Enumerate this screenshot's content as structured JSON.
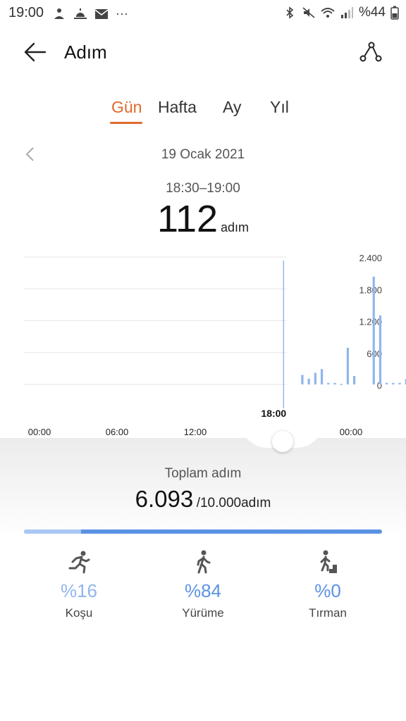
{
  "status_bar": {
    "time": "19:00",
    "battery": "%44",
    "ellipsis": "···"
  },
  "header": {
    "title": "Adım"
  },
  "tabs": [
    {
      "label": "Gün",
      "active": true
    },
    {
      "label": "Hafta",
      "active": false
    },
    {
      "label": "Ay",
      "active": false
    },
    {
      "label": "Yıl",
      "active": false
    }
  ],
  "date": "19 Ocak 2021",
  "selected": {
    "range": "18:30–19:00",
    "value": "112",
    "unit": "adım"
  },
  "chart_data": {
    "type": "bar",
    "y_tick_labels": [
      "2.400",
      "1.800",
      "1.200",
      "600",
      "0"
    ],
    "y_ticks": [
      2400,
      1800,
      1200,
      600,
      0
    ],
    "x_tick_labels": [
      "00:00",
      "06:00",
      "12:00",
      "18:00",
      "00:00"
    ],
    "x_ticks_hours": [
      0,
      6,
      12,
      18,
      24
    ],
    "selected_tick_label": "18:00",
    "ylim": [
      0,
      2400
    ],
    "grid": true,
    "interval_hours": 0.5,
    "values": [
      0,
      0,
      0,
      0,
      0,
      0,
      0,
      0,
      0,
      0,
      0,
      0,
      0,
      0,
      0,
      0,
      0,
      0,
      0,
      0,
      0,
      0,
      0,
      0,
      0,
      0,
      0,
      0,
      0,
      0,
      0,
      0,
      0,
      0,
      0,
      0,
      0,
      0,
      0,
      0,
      180,
      110,
      220,
      290,
      30,
      30,
      10,
      690,
      160,
      0,
      0,
      2030,
      1300,
      30,
      30,
      30,
      100,
      110,
      110,
      200,
      190,
      112,
      0,
      0,
      0,
      0,
      0,
      0,
      0,
      0,
      0,
      0,
      0,
      0,
      0,
      0,
      0,
      0,
      0,
      0,
      0,
      0,
      0,
      0,
      0,
      0,
      0,
      0,
      0,
      0,
      0,
      0,
      0,
      0,
      0,
      0,
      0,
      0,
      0,
      0,
      0,
      0,
      0,
      0,
      0,
      0,
      0,
      0,
      0,
      0,
      0,
      0,
      0,
      0,
      0,
      0,
      0,
      0,
      0,
      0,
      0,
      0,
      0,
      0
    ],
    "selected_index": 37,
    "bar_color": "#8fb6ec",
    "selected_color": "#1f5fbf"
  },
  "summary": {
    "label": "Toplam adım",
    "total": "6.093",
    "goal": "/10.000adım",
    "progress_fraction": 0.609
  },
  "activities": [
    {
      "name": "Koşu",
      "percent": "%16",
      "icon": "running-icon"
    },
    {
      "name": "Yürüme",
      "percent": "%84",
      "icon": "walking-icon"
    },
    {
      "name": "Tırman",
      "percent": "%0",
      "icon": "climbing-icon"
    }
  ],
  "colors": {
    "accent": "#e06a2a",
    "bar": "#8fb6ec",
    "progress": "#5b93e4"
  }
}
